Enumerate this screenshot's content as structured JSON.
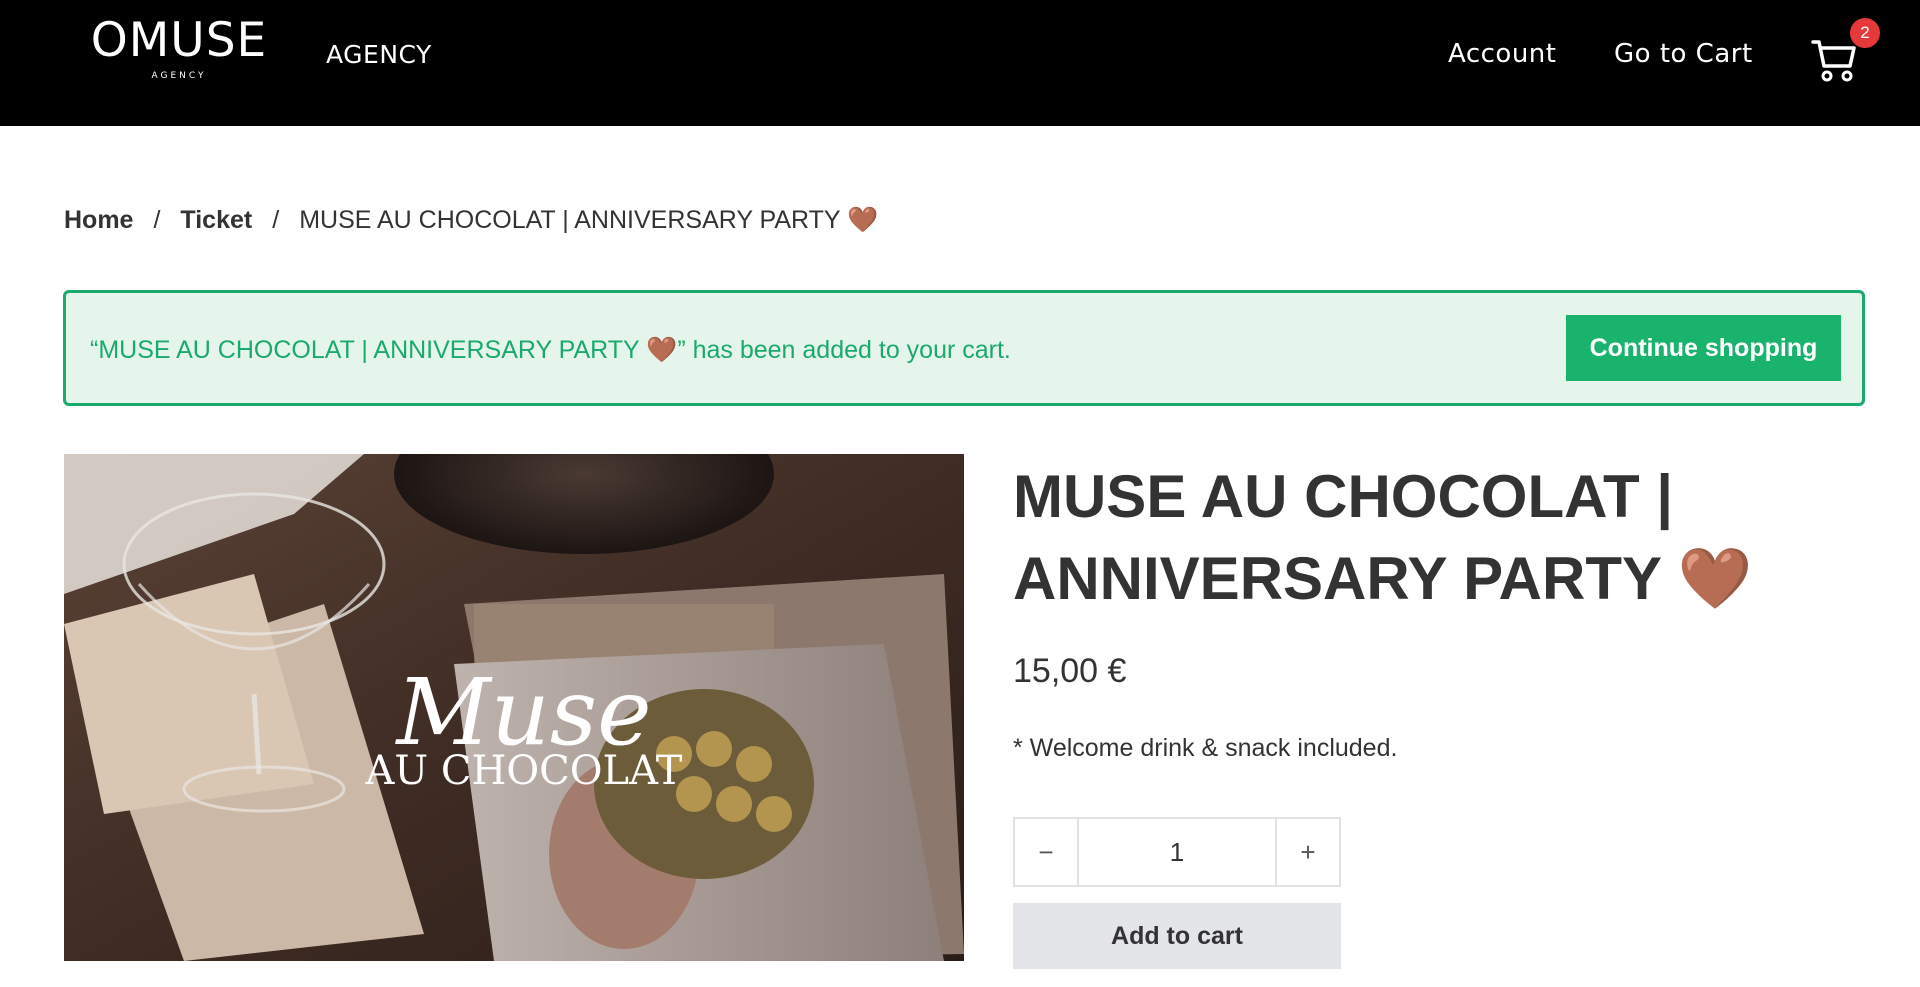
{
  "header": {
    "logo_main": "OMUSE",
    "logo_sub": "AGENCY",
    "agency_link": "AGENCY",
    "nav": {
      "account": "Account",
      "go_to_cart": "Go to Cart"
    },
    "cart_count": "2",
    "cart_icon": "shopping-cart-icon"
  },
  "breadcrumb": {
    "home": "Home",
    "separator": "/",
    "ticket": "Ticket",
    "current": "MUSE AU CHOCOLAT | ANNIVERSARY PARTY 🤎"
  },
  "notice": {
    "message": "“MUSE AU CHOCOLAT | ANNIVERSARY PARTY 🤎” has been added to your cart.",
    "button_label": "Continue shopping"
  },
  "product": {
    "image_text_script": "Muse",
    "image_text_caps": "AU CHOCOLAT",
    "title": "MUSE AU CHOCOLAT | ANNIVERSARY PARTY 🤎",
    "price": "15,00 €",
    "short_description": "* Welcome drink & snack included.",
    "quantity": "1",
    "qty_minus": "−",
    "qty_plus": "+",
    "add_to_cart_label": "Add to cart"
  },
  "colors": {
    "header_bg": "#000000",
    "notice_green": "#1aaa6b",
    "notice_bg": "#e6f5ec",
    "badge_red": "#e63a3a",
    "add_to_cart_bg": "#e3e5e8"
  }
}
